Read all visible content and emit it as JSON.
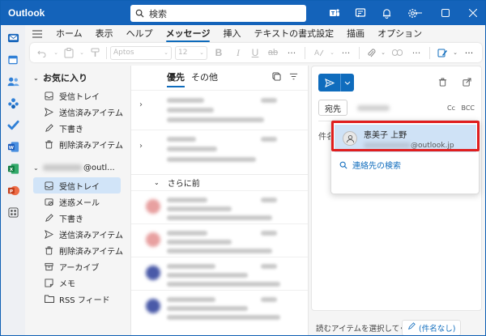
{
  "app": {
    "title": "Outlook"
  },
  "search": {
    "placeholder": "検索"
  },
  "menu": {
    "items": [
      "ホーム",
      "表示",
      "ヘルプ",
      "メッセージ",
      "挿入",
      "テキストの書式設定",
      "描画",
      "オプション"
    ],
    "active_index": 3
  },
  "ribbon": {
    "font_name": "Aptos",
    "font_size": "12"
  },
  "folders": {
    "favorites_label": "お気に入り",
    "favorites": [
      "受信トレイ",
      "送信済みアイテム",
      "下書き",
      "削除済みアイテム"
    ],
    "account_suffix": "@outl...",
    "account_items": [
      "受信トレイ",
      "迷惑メール",
      "下書き",
      "送信済みアイテム",
      "削除済みアイテム",
      "アーカイブ",
      "メモ",
      "RSS フィード"
    ],
    "selected": "受信トレイ"
  },
  "message_list": {
    "tabs": [
      "優先",
      "その他"
    ],
    "group_label": "さらに前"
  },
  "compose": {
    "to_label": "宛先",
    "cc_label": "Cc",
    "bcc_label": "BCC",
    "subject_label": "件名"
  },
  "suggestion": {
    "name": "恵美子 上野",
    "email_domain": "@outlook.jp",
    "search_contacts": "連絡先の検索"
  },
  "bottom_tabs": {
    "reading": "読むアイテムを選択してく...",
    "draft": "(件名なし)"
  },
  "colors": {
    "brand": "#1463ba",
    "accent": "#0f6cbd",
    "highlight": "#e01e1e"
  }
}
